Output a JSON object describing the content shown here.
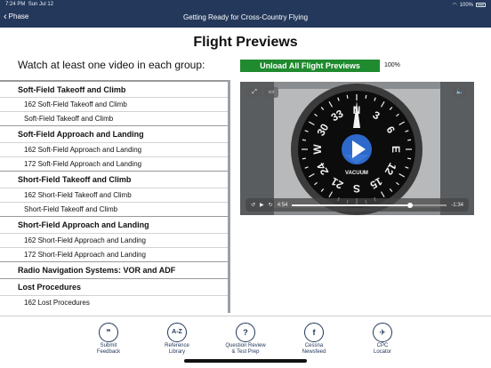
{
  "status_bar": {
    "time": "7:24 PM",
    "date": "Sun Jul 12",
    "battery_text": "100%"
  },
  "nav": {
    "back_label": "Phase",
    "title": "Getting Ready for Cross-Country Flying"
  },
  "page": {
    "title": "Flight Previews",
    "instruction": "Watch at least one video in each group:"
  },
  "unload": {
    "label": "Unload All Flight Previews",
    "percent_text": "100%",
    "progress": 1.0
  },
  "groups": [
    {
      "title": "Soft-Field Takeoff and Climb",
      "items": [
        "162 Soft-Field Takeoff and Climb",
        "Soft-Field Takeoff and Climb"
      ]
    },
    {
      "title": "Soft-Field Approach and Landing",
      "items": [
        "162 Soft-Field Approach and Landing",
        "172 Soft-Field Approach and Landing"
      ]
    },
    {
      "title": "Short-Field Takeoff and Climb",
      "items": [
        "162 Short-Field Takeoff and Climb",
        "Short-Field Takeoff and Climb"
      ]
    },
    {
      "title": "Short-Field Approach and Landing",
      "items": [
        "162 Short-Field Approach and Landing",
        "172 Short-Field Approach and Landing"
      ]
    },
    {
      "title": "Radio Navigation Systems: VOR and ADF",
      "items": []
    },
    {
      "title": "Lost Procedures",
      "items": [
        "162 Lost Procedures"
      ]
    }
  ],
  "video": {
    "time_elapsed": "4:54",
    "time_remaining": "-1:34",
    "playback_progress": 0.76,
    "gauge_label": "VACUUM",
    "dial_marks": [
      "33",
      "N",
      "3",
      "6",
      "E",
      "12",
      "15",
      "S",
      "21",
      "24",
      "W",
      "30"
    ]
  },
  "tabs": [
    {
      "glyph": "❞",
      "label": "Submit\nFeedback",
      "icon": "quote-icon"
    },
    {
      "glyph": "A-Z",
      "label": "Reference\nLibrary",
      "icon": "az-icon"
    },
    {
      "glyph": "?",
      "label": "Question Review\n& Test Prep",
      "icon": "question-icon"
    },
    {
      "glyph": "f",
      "label": "Cessna\nNewsfeed",
      "icon": "facebook-icon"
    },
    {
      "glyph": "✈",
      "label": "CPC\nLocator",
      "icon": "locator-icon"
    }
  ]
}
